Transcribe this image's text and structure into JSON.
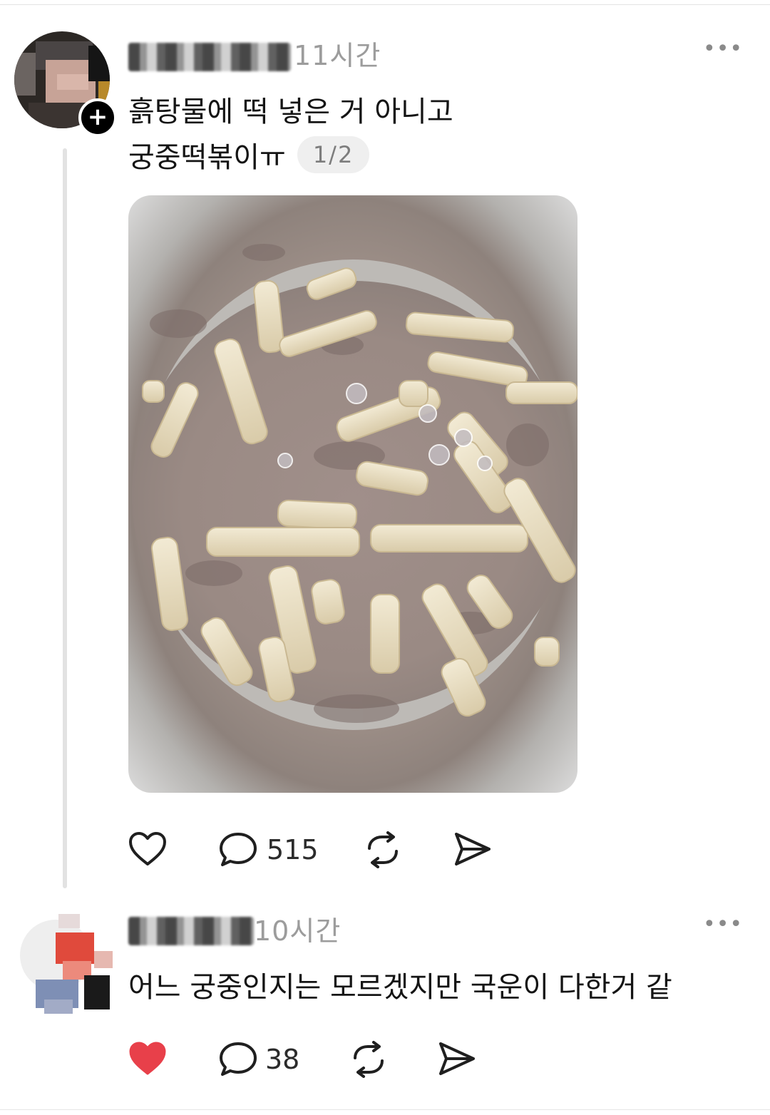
{
  "post": {
    "username": "hwawha29",
    "time": "11시간",
    "more_label": "•••",
    "text_line1": "흙탕물에 떡 넣은 거 아니고",
    "text_line2": "궁중떡볶이ㅠ",
    "page_counter": "1/2",
    "image_description": "궁중떡볶이",
    "actions": {
      "like_icon": "heart-outline-icon",
      "reply_count": "515",
      "repost_icon": "repost-icon",
      "share_icon": "send-icon"
    }
  },
  "reply": {
    "time": "10시간",
    "more_label": "•••",
    "text": "어느 궁중인지는 모르겠지만 국운이 다한거 같",
    "actions": {
      "like_icon": "heart-filled-icon",
      "reply_count": "38",
      "repost_icon": "repost-icon",
      "share_icon": "send-icon"
    }
  },
  "colors": {
    "like_active": "#e8404a",
    "text_primary": "#141414",
    "text_muted": "#9c9c9c",
    "divider": "#e2e2e2"
  }
}
